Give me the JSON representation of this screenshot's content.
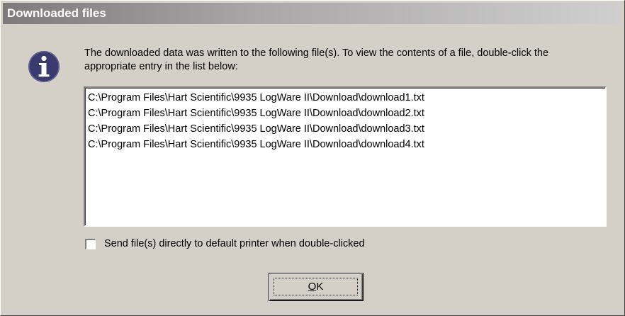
{
  "window": {
    "title": "Downloaded files"
  },
  "message": {
    "icon": "info-icon",
    "text": "The downloaded data was written to the following file(s). To view the contents of a file, double-click the appropriate entry in the list below:"
  },
  "file_list": {
    "items": [
      "C:\\Program Files\\Hart Scientific\\9935 LogWare II\\Download\\download1.txt",
      "C:\\Program Files\\Hart Scientific\\9935 LogWare II\\Download\\download2.txt",
      "C:\\Program Files\\Hart Scientific\\9935 LogWare II\\Download\\download3.txt",
      "C:\\Program Files\\Hart Scientific\\9935 LogWare II\\Download\\download4.txt"
    ]
  },
  "print_option": {
    "label": "Send file(s) directly to default printer when double-clicked",
    "checked": false
  },
  "ok_button": {
    "label": "OK",
    "mnemonic": "O",
    "rest": "K"
  },
  "colors": {
    "dialog_bg": "#d4d0c8",
    "titlebar_start": "#7c7a7a",
    "titlebar_end": "#d0cfcf",
    "icon_fill": "#3a3a6e"
  }
}
